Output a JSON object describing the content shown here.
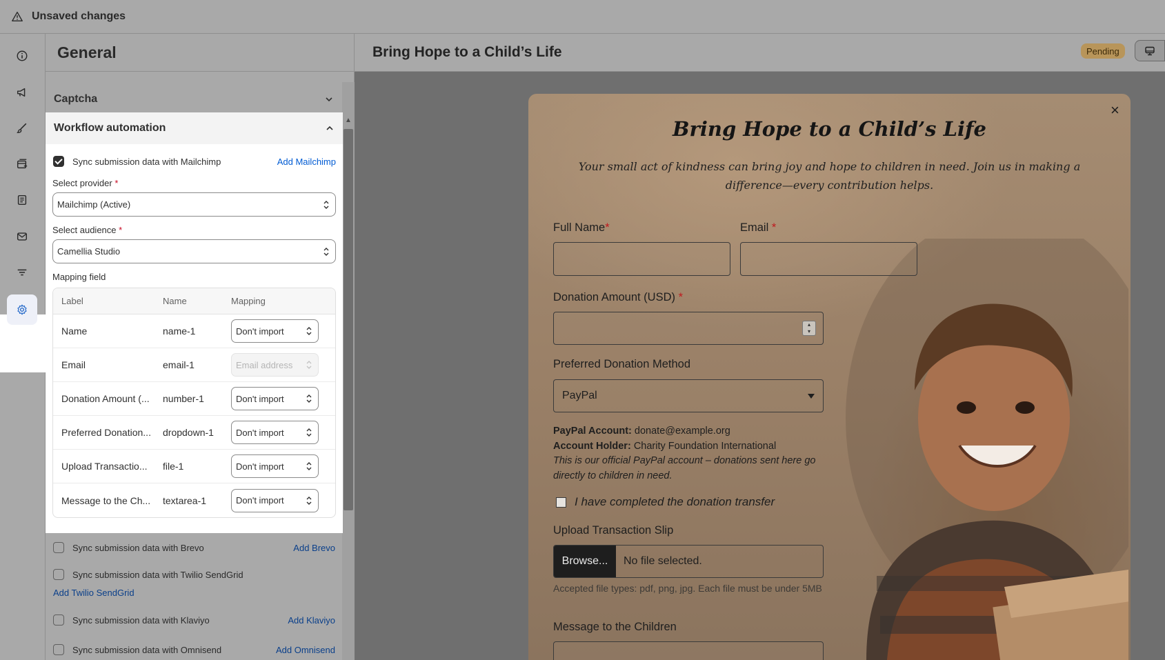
{
  "topbar": {
    "title": "Unsaved changes",
    "icon": "alert-triangle-icon"
  },
  "rail": {
    "items": [
      "info-icon",
      "megaphone-icon",
      "paintbrush-icon",
      "form-add-icon",
      "receipt-icon",
      "mail-icon",
      "filter-icon",
      "settings-icon"
    ],
    "active": "settings-icon"
  },
  "panel": {
    "title": "General",
    "captcha_label": "Captcha",
    "workflow": {
      "title": "Workflow automation",
      "mailchimp": {
        "label": "Sync submission data with Mailchimp",
        "link": "Add Mailchimp",
        "checked": true
      },
      "provider_label": "Select provider",
      "provider_value": "Mailchimp (Active)",
      "audience_label": "Select audience",
      "audience_value": "Camellia Studio",
      "mapping_label": "Mapping field",
      "columns": [
        "Label",
        "Name",
        "Mapping"
      ],
      "rows": [
        {
          "label": "Name",
          "name": "name-1",
          "mapping": "Don't import",
          "disabled": false
        },
        {
          "label": "Email",
          "name": "email-1",
          "mapping": "Email address",
          "disabled": true
        },
        {
          "label": "Donation Amount (...",
          "name": "number-1",
          "mapping": "Don't import",
          "disabled": false
        },
        {
          "label": "Preferred Donation...",
          "name": "dropdown-1",
          "mapping": "Don't import",
          "disabled": false
        },
        {
          "label": "Upload Transactio...",
          "name": "file-1",
          "mapping": "Don't import",
          "disabled": false
        },
        {
          "label": "Message to the Ch...",
          "name": "textarea-1",
          "mapping": "Don't import",
          "disabled": false
        }
      ]
    },
    "integrations": [
      {
        "label": "Sync submission data with Brevo",
        "link": "Add Brevo"
      },
      {
        "label": "Sync submission data with Twilio SendGrid",
        "link": "Add Twilio SendGrid"
      },
      {
        "label": "Sync submission data with Klaviyo",
        "link": "Add Klaviyo"
      },
      {
        "label": "Sync submission data with Omnisend",
        "link": "Add Omnisend"
      }
    ]
  },
  "preview": {
    "title": "Bring Hope to a Child’s Life",
    "status": "Pending",
    "form": {
      "title": "Bring Hope to a Child’s Life",
      "subtitle": "Your small act of kindness can bring joy and hope to children in need. Join us in making a difference—every contribution helps.",
      "full_name_label": "Full Name",
      "email_label": "Email",
      "amount_label": "Donation Amount (USD)",
      "method_label": "Preferred Donation Method",
      "method_value": "PayPal",
      "paypal_account_label": "PayPal Account:",
      "paypal_account_value": "donate@example.org",
      "holder_label": "Account Holder:",
      "holder_value": "Charity Foundation International",
      "note": "This is our official PayPal account – donations sent here go directly to children in need.",
      "confirm_label": "I have completed the donation transfer",
      "upload_label": "Upload Transaction Slip",
      "browse_label": "Browse...",
      "no_file": "No file selected.",
      "file_help": "Accepted file types: pdf, png, jpg. Each file must be under 5MB",
      "message_label": "Message to the Children",
      "required_mark": "*",
      "close_glyph": "×"
    }
  }
}
